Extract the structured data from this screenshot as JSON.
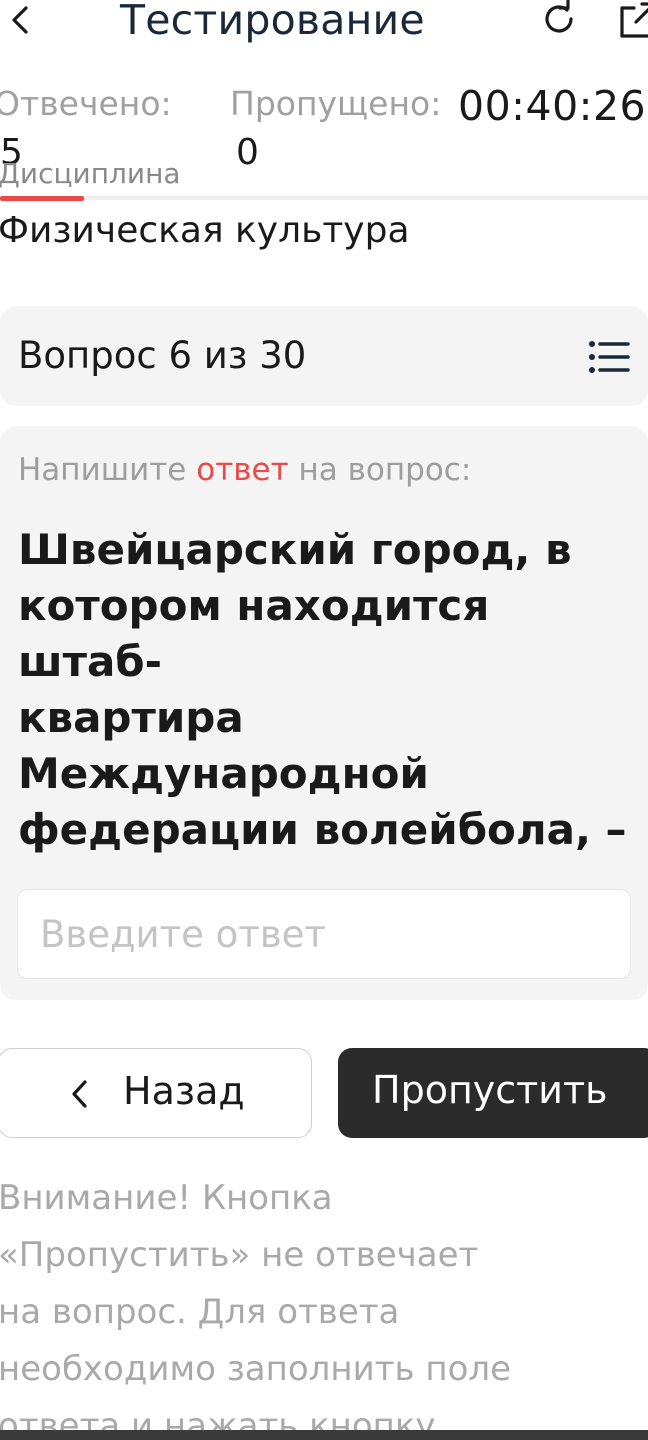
{
  "header": {
    "title": "Тестирование",
    "back_icon": "chevron-left-icon",
    "refresh_icon": "refresh-icon",
    "external_icon": "external-link-icon"
  },
  "stats": {
    "answered_label": "Отвечено:",
    "answered_value": "5",
    "skipped_label": "Пропущено:",
    "skipped_value": "0",
    "timer": "00:40:26"
  },
  "discipline": {
    "label": "Дисциплина",
    "name": "Физическая культура"
  },
  "question_nav": {
    "counter": "Вопрос 6 из 30",
    "list_icon": "list-icon"
  },
  "question": {
    "instruction_prefix": "Напишите ",
    "instruction_accent": "ответ",
    "instruction_suffix": " на вопрос:",
    "lines": [
      "Швейцарский город, в",
      "котором находится штаб-",
      "квартира",
      "Международной",
      "федерации волейбола, –",
      "..."
    ],
    "answer_placeholder": "Введите ответ",
    "answer_value": ""
  },
  "buttons": {
    "back_label": "Назад",
    "skip_label": "Пропустить"
  },
  "warning": {
    "lines": [
      "Внимание! Кнопка",
      "«Пропустить» не отвечает",
      "на вопрос. Для ответа",
      "необходимо заполнить поле",
      "ответа и нажать кнопку"
    ]
  },
  "colors": {
    "accent": "#e84a4a",
    "dark_button": "#2b2b2b",
    "card_bg": "#f4f4f4",
    "muted_text": "#a0a0a0"
  }
}
